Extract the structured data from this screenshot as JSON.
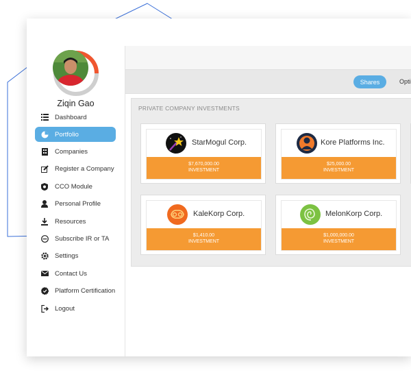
{
  "user": {
    "name": "Ziqin Gao"
  },
  "sidebar": {
    "items": [
      {
        "label": "Dashboard",
        "icon": "list-icon"
      },
      {
        "label": "Portfolio",
        "icon": "pie-chart-icon",
        "active": true
      },
      {
        "label": "Companies",
        "icon": "building-icon"
      },
      {
        "label": "Register a Company",
        "icon": "edit-icon"
      },
      {
        "label": "CCO Module",
        "icon": "shield-icon"
      },
      {
        "label": "Personal Profile",
        "icon": "user-icon"
      },
      {
        "label": "Resources",
        "icon": "download-icon"
      },
      {
        "label": "Subscribe IR or TA",
        "icon": "minus-circle-icon"
      },
      {
        "label": "Settings",
        "icon": "gear-icon"
      },
      {
        "label": "Contact Us",
        "icon": "mail-icon"
      },
      {
        "label": "Platform Certification",
        "icon": "badge-icon"
      },
      {
        "label": "Logout",
        "icon": "logout-icon"
      }
    ]
  },
  "tabs": {
    "shares": "Shares",
    "options": "Opti"
  },
  "panel": {
    "title": "PRIVATE COMPANY INVESTMENTS"
  },
  "investments": [
    {
      "name": "StarMogul Corp.",
      "amount": "$7,670,000.00",
      "label": "INVESTMENT",
      "logo": "starmogul-logo"
    },
    {
      "name": "Kore Platforms Inc.",
      "amount": "$25,000.00",
      "label": "INVESTMENT",
      "logo": "kore-logo"
    },
    {
      "name": "KaleKorp Corp.",
      "amount": "$1,410.00",
      "label": "INVESTMENT",
      "logo": "kalekorp-logo"
    },
    {
      "name": "MelonKorp Corp.",
      "amount": "$1,000,000.00",
      "label": "INVESTMENT",
      "logo": "melonkorp-logo"
    }
  ],
  "colors": {
    "accent": "#5aade3",
    "investment": "#f59a33",
    "hexagon_line": "#3a6fd8"
  }
}
